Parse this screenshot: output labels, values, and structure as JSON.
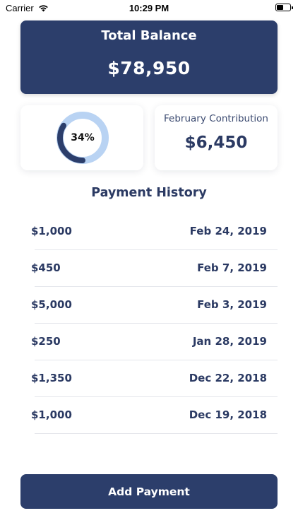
{
  "status_bar": {
    "carrier": "Carrier",
    "time": "10:29 PM",
    "icons": [
      "wifi-icon",
      "battery-icon"
    ]
  },
  "balance": {
    "title": "Total Balance",
    "value": "$78,950"
  },
  "progress": {
    "label": "34%",
    "fraction": 0.34,
    "track_color": "#b9d3f3",
    "fill_color": "#2c3e6b"
  },
  "contribution": {
    "label": "February Contribution",
    "value": "$6,450"
  },
  "history": {
    "title": "Payment History",
    "rows": [
      {
        "amount": "$1,000",
        "date": "Feb 24, 2019"
      },
      {
        "amount": "$450",
        "date": "Feb 7, 2019"
      },
      {
        "amount": "$5,000",
        "date": "Feb 3, 2019"
      },
      {
        "amount": "$250",
        "date": "Jan 28, 2019"
      },
      {
        "amount": "$1,350",
        "date": "Dec 22, 2018"
      },
      {
        "amount": "$1,000",
        "date": "Dec 19, 2018"
      }
    ]
  },
  "actions": {
    "add_payment_label": "Add Payment"
  },
  "colors": {
    "primary": "#2c3e6b",
    "text": "#2b3a63",
    "divider": "#e4e6eb"
  }
}
